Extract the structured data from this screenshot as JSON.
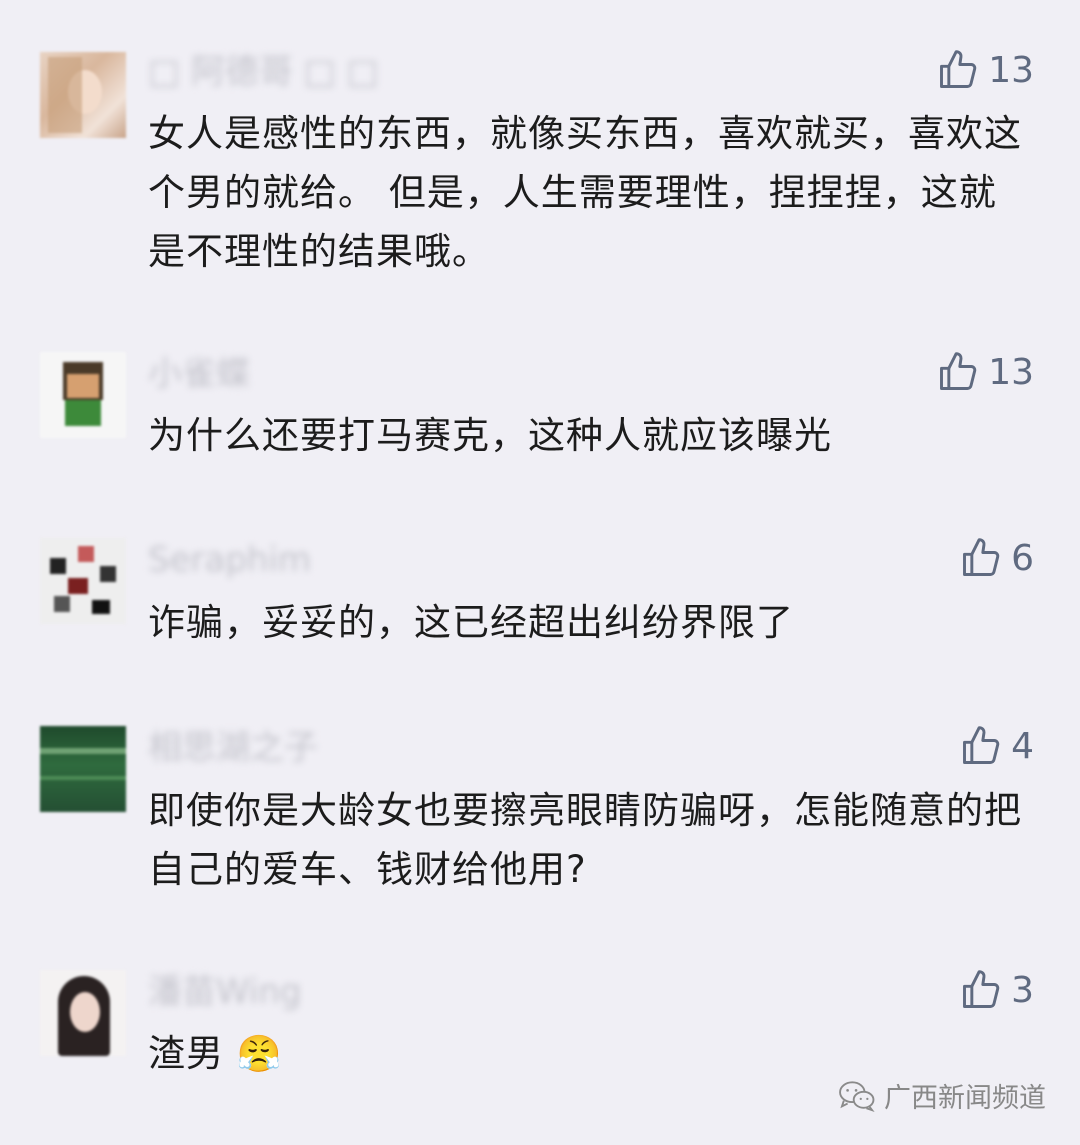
{
  "comments": [
    {
      "username": "□ 阿德哥 □ □",
      "likes": "13",
      "text": "女人是感性的东西，就像买东西，喜欢就买，喜欢这个男的就给。 但是，人生需要理性，捏捏捏，这就是不理性的结果哦。"
    },
    {
      "username": "小雀蝶",
      "likes": "13",
      "text": "为什么还要打马赛克，这种人就应该曝光"
    },
    {
      "username": "Seraphim",
      "likes": "6",
      "text": "诈骗，妥妥的，这已经超出纠纷界限了"
    },
    {
      "username": "相思湖之子",
      "likes": "4",
      "text": "即使你是大龄女也要擦亮眼睛防骗呀，怎能随意的把自己的爱车、钱财给他用?"
    },
    {
      "username": "潘苗Wing",
      "likes": "3",
      "text": "渣男",
      "emoji": "😤"
    }
  ],
  "watermark": {
    "text": "广西新闻频道"
  },
  "icons": {
    "like": "thumbs-up-icon",
    "watermark": "wechat-icon"
  },
  "colors": {
    "background": "#f0eff5",
    "like": "#5f6a80",
    "text": "#1c1c1c"
  }
}
